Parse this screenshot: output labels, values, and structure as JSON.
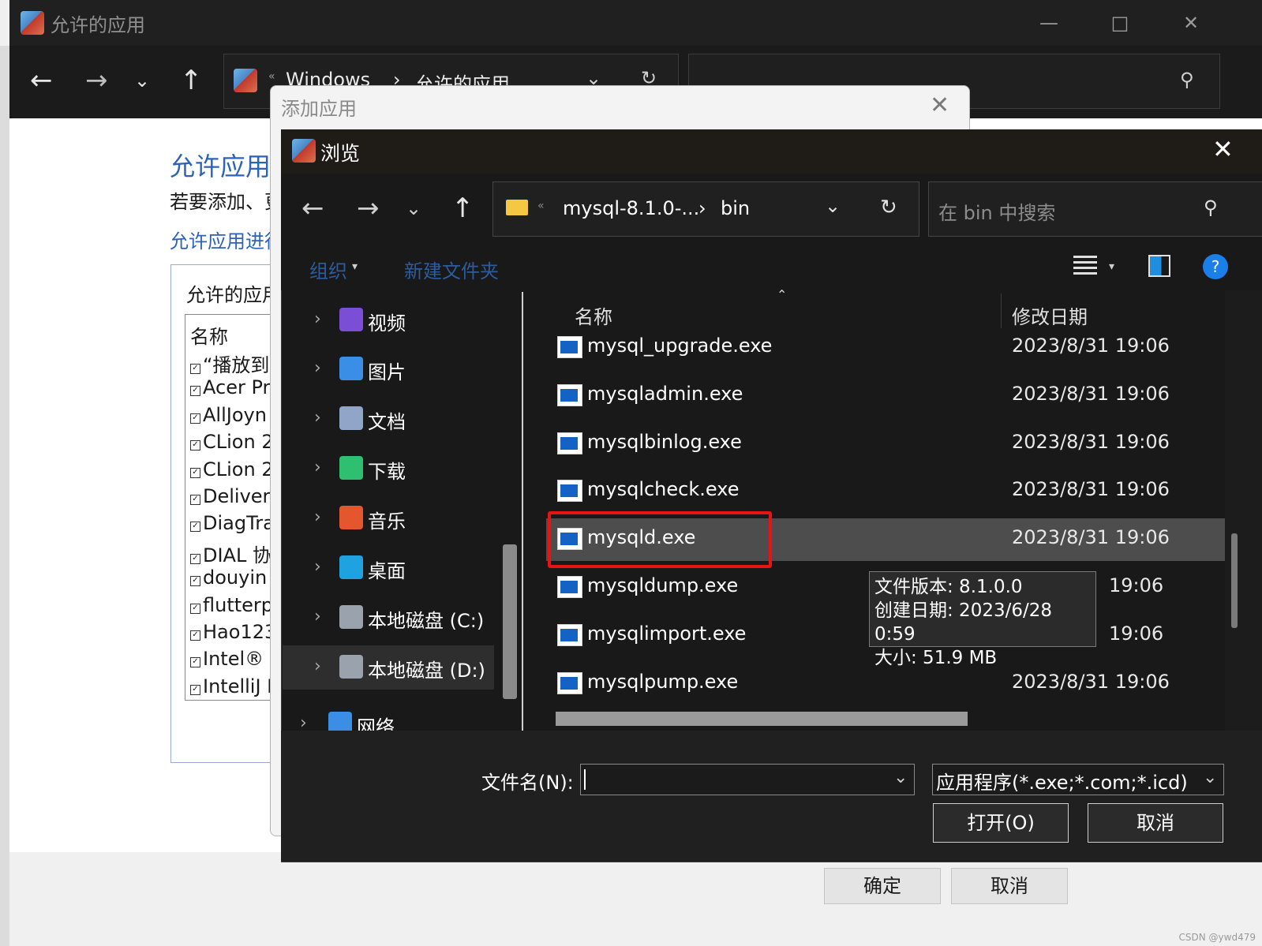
{
  "background_window": {
    "title": "允许的应用",
    "address_crumbs": [
      "Windows",
      "允许的应用"
    ],
    "heading": "允许应用",
    "subtext": "若要添加、更",
    "link": "允许应用进行",
    "group_title": "允许的应用",
    "list_header": "名称",
    "list_items": [
      "“播放到设",
      "Acer Pro",
      "AllJoyn",
      "CLion 2",
      "CLion 2",
      "Delivery",
      "DiagTra",
      "DIAL 协",
      "douyin",
      "flutterp",
      "Hao123",
      "Intel® C",
      "IntelliJ I"
    ],
    "ok_label": "确定",
    "cancel_label": "取消"
  },
  "add_dialog": {
    "title": "添加应用"
  },
  "browse_dialog": {
    "title": "浏览",
    "address": {
      "folder": "mysql-8.1.0-...",
      "current": "bin"
    },
    "search_placeholder": "在 bin 中搜索",
    "commands": {
      "organize": "组织",
      "new_folder": "新建文件夹"
    },
    "nav_items": [
      {
        "label": "视频",
        "icon": "video-folder-icon",
        "color": "#7a4fd6"
      },
      {
        "label": "图片",
        "icon": "pictures-folder-icon",
        "color": "#3a8ee6"
      },
      {
        "label": "文档",
        "icon": "documents-folder-icon",
        "color": "#8fa6c8"
      },
      {
        "label": "下载",
        "icon": "downloads-folder-icon",
        "color": "#2fbf71"
      },
      {
        "label": "音乐",
        "icon": "music-folder-icon",
        "color": "#e4572e"
      },
      {
        "label": "桌面",
        "icon": "desktop-folder-icon",
        "color": "#1fa3e0"
      },
      {
        "label": "本地磁盘 (C:)",
        "icon": "drive-c-icon",
        "color": "#9aa3ad"
      },
      {
        "label": "本地磁盘 (D:)",
        "icon": "drive-d-icon",
        "color": "#9aa3ad"
      },
      {
        "label": "网络",
        "icon": "network-icon",
        "color": "#3a8ee6"
      }
    ],
    "columns": {
      "name": "名称",
      "modified": "修改日期"
    },
    "files": [
      {
        "name": "mysql_upgrade.exe",
        "date": "2023/8/31 19:06"
      },
      {
        "name": "mysqladmin.exe",
        "date": "2023/8/31 19:06"
      },
      {
        "name": "mysqlbinlog.exe",
        "date": "2023/8/31 19:06"
      },
      {
        "name": "mysqlcheck.exe",
        "date": "2023/8/31 19:06"
      },
      {
        "name": "mysqld.exe",
        "date": "2023/8/31 19:06",
        "selected": true
      },
      {
        "name": "mysqldump.exe",
        "date": "19:06"
      },
      {
        "name": "mysqlimport.exe",
        "date": "19:06"
      },
      {
        "name": "mysqlpump.exe",
        "date": "2023/8/31 19:06"
      }
    ],
    "tooltip": {
      "version": "文件版本: 8.1.0.0",
      "created": "创建日期: 2023/6/28 0:59",
      "size": "大小: 51.9 MB"
    },
    "filename_label": "文件名(N):",
    "filename_value": "",
    "filetype": "应用程序(*.exe;*.com;*.icd)",
    "open_label": "打开(O)",
    "cancel_label": "取消",
    "accent_color": "#e81313"
  },
  "watermark": "CSDN @ywd479"
}
